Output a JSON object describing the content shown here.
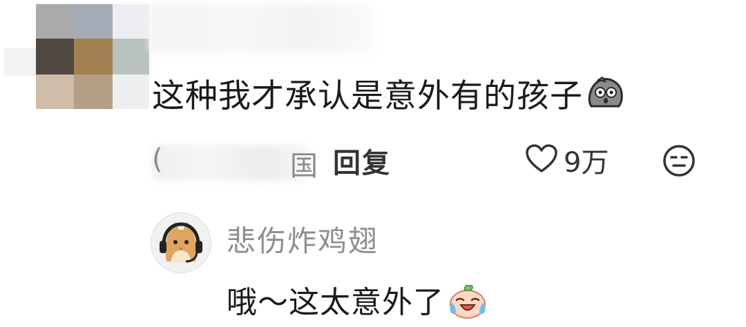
{
  "comment": {
    "text": "这种我才承认是意外有的孩子",
    "emoji": "rock-face-emoji",
    "meta_paren": "(",
    "meta_tail": "国",
    "reply_label": "回复",
    "like_count": "9万"
  },
  "reply": {
    "author": "悲伤炸鸡翅",
    "text": "哦～这太意外了",
    "emoji": "crying-laughing-emoji"
  },
  "colors": {
    "mosaic": [
      "#a7aaae",
      "#4d4640",
      "#a17f52",
      "#bcc4bf",
      "#cdbca8",
      "#b3a08a",
      "#eef0f2"
    ]
  }
}
